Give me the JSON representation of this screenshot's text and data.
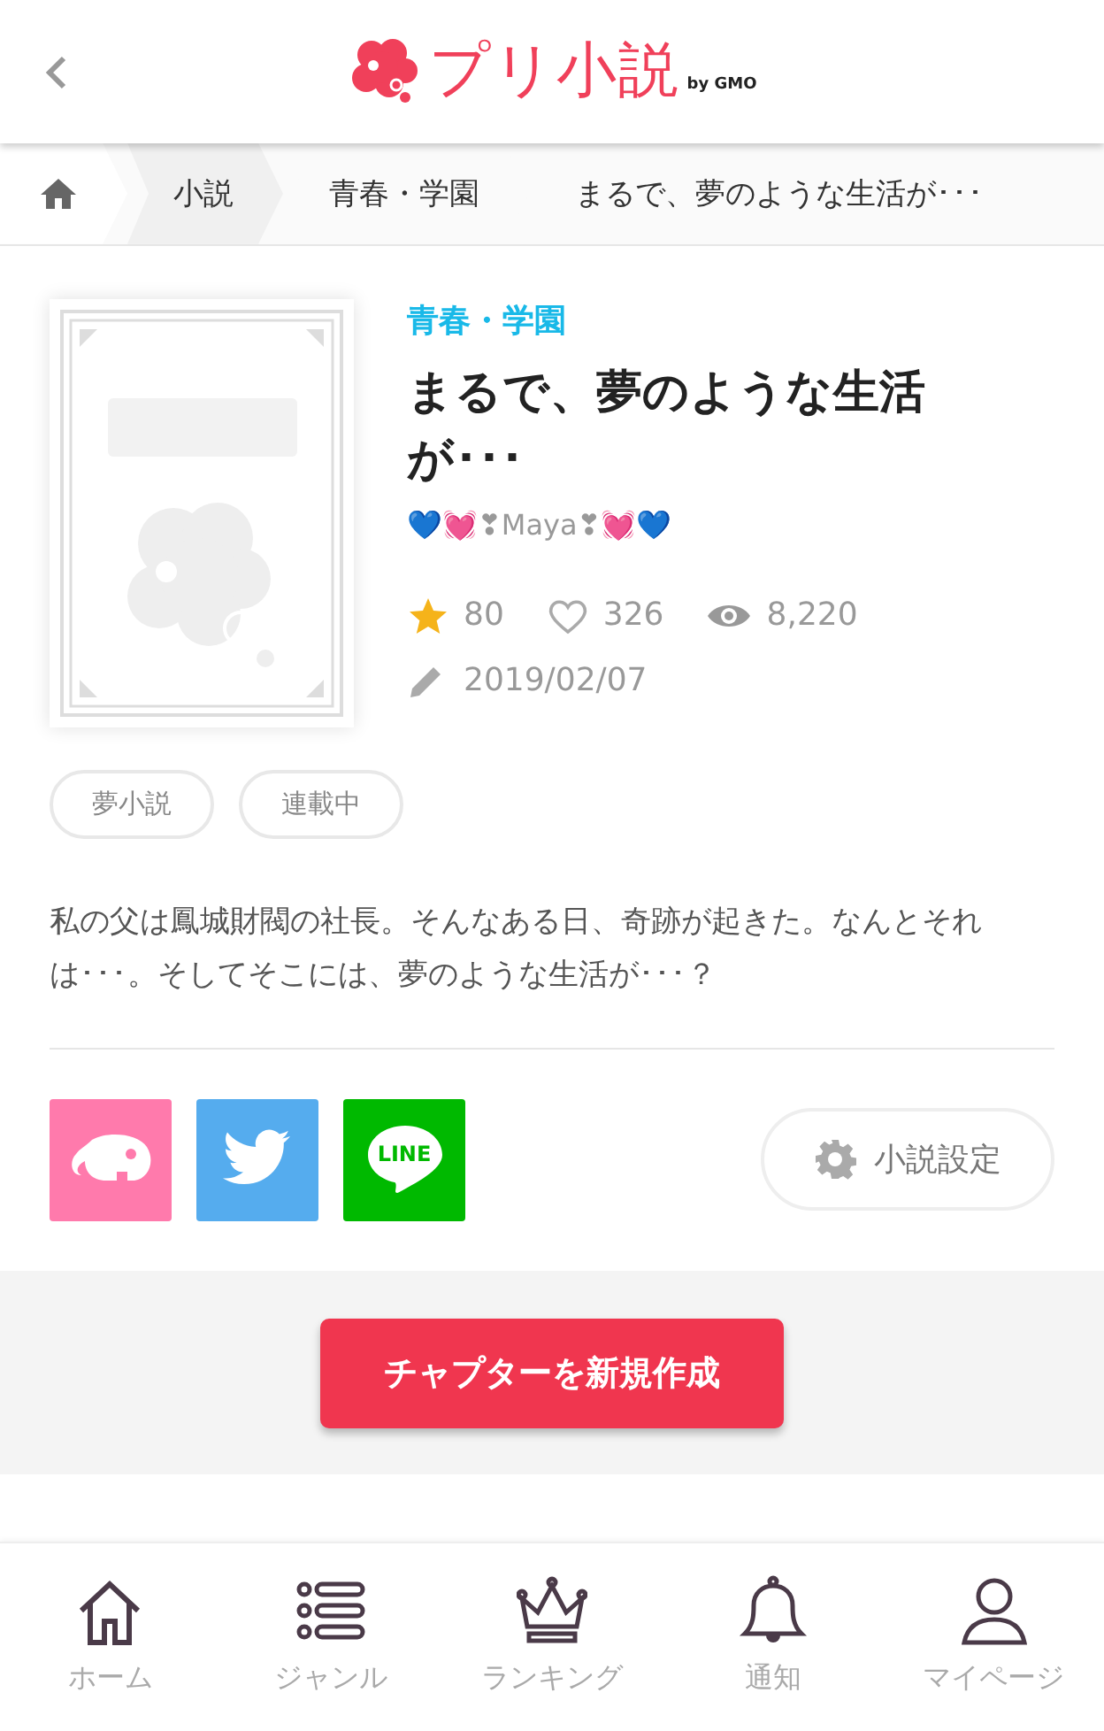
{
  "header": {
    "logo_text": "プリ小説",
    "logo_by": "by GMO"
  },
  "breadcrumbs": [
    {
      "label": "小説"
    },
    {
      "label": "青春・学園"
    },
    {
      "label": "まるで、夢のような生活が･･･"
    }
  ],
  "novel": {
    "category": "青春・学園",
    "title": "まるで、夢のような生活が･･･",
    "author": "💙💓❣Maya❣💓💙",
    "stars": "80",
    "likes": "326",
    "views": "8,220",
    "updated": "2019/02/07",
    "tags": [
      "夢小説",
      "連載中"
    ],
    "description": "私の父は鳳城財閥の社長。そんなある日、奇跡が起きた。なんとそれは･･･。そしてそこには、夢のような生活が･･･？"
  },
  "share": [
    {
      "kind": "elephant",
      "color": "#ff7aac"
    },
    {
      "kind": "twitter",
      "color": "#55acee"
    },
    {
      "kind": "line",
      "color": "#00b900",
      "text": "LINE"
    }
  ],
  "settings_button": "小説設定",
  "create_button": "チャプターを新規作成",
  "nav": [
    {
      "kind": "home",
      "label": "ホーム"
    },
    {
      "kind": "list",
      "label": "ジャンル"
    },
    {
      "kind": "crown",
      "label": "ランキング"
    },
    {
      "kind": "bell",
      "label": "通知"
    },
    {
      "kind": "person",
      "label": "マイページ"
    }
  ]
}
